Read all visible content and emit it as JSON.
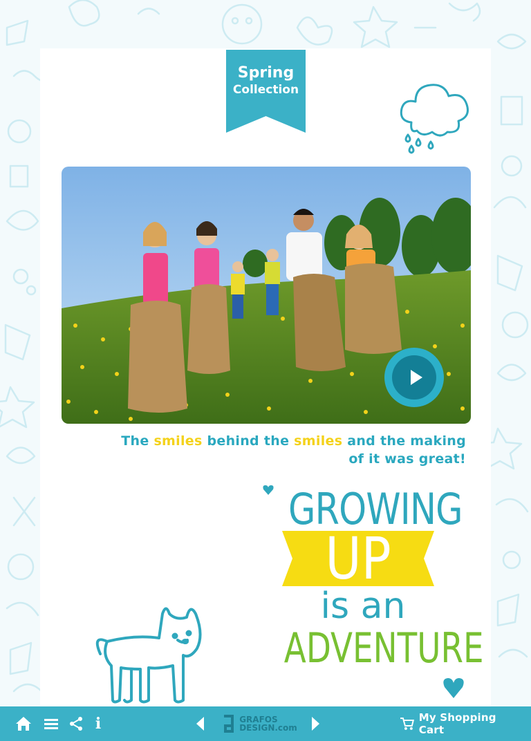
{
  "ribbon": {
    "line1": "Spring",
    "line2": "Collection"
  },
  "photo": {
    "alt": "Children racing in sacks on a flowery meadow"
  },
  "video": {
    "play_icon": "play-icon"
  },
  "caption": {
    "part1": "The ",
    "hl1": "smiles",
    "part2": " behind the ",
    "hl2": "smiles",
    "part3": " and the making",
    "line2": "of it was great!"
  },
  "headline": {
    "growing": "GROWING",
    "up": "UP",
    "is_an": "is an",
    "adventure": "ADVENTURE"
  },
  "toolbar": {
    "home_icon": "home-icon",
    "menu_icon": "menu-icon",
    "share_icon": "share-icon",
    "info_label": "i",
    "prev_icon": "chevron-left-icon",
    "next_icon": "chevron-right-icon",
    "logo_line1": "GRAFOS",
    "logo_line2": "DESIGN.com",
    "cart_label": "My Shopping Cart"
  },
  "colors": {
    "teal": "#3bb1c7",
    "dark_teal": "#137f96",
    "yellow": "#f4d21b",
    "green": "#78c032",
    "caption_blue": "#2aa8bf"
  }
}
